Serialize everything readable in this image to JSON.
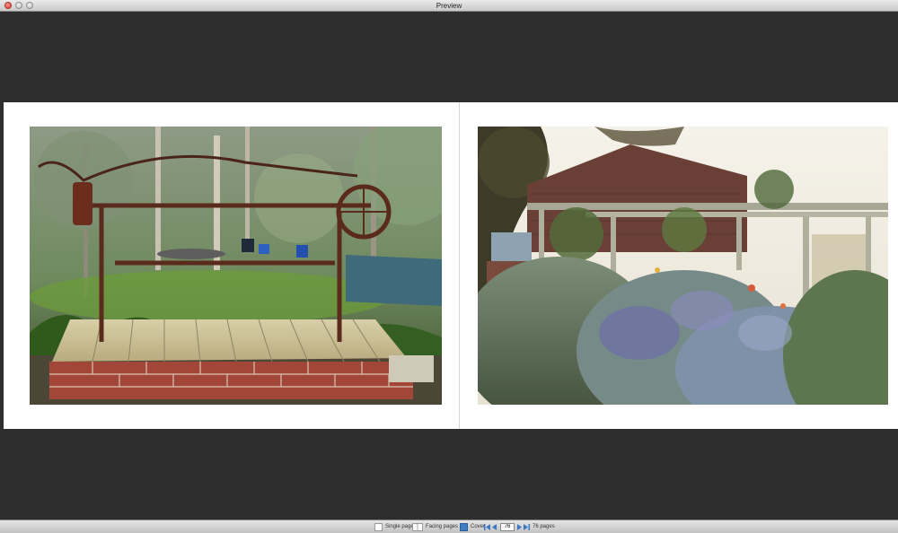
{
  "window": {
    "title": "Preview"
  },
  "toolbar": {
    "single_pages_label": "Single pages",
    "facing_pages_label": "Facing pages",
    "cover_label": "Cover",
    "current_page": "76",
    "page_count_label": "76 pages"
  },
  "colors": {
    "background": "#2e2e2e",
    "page": "#ffffff",
    "toolbar": "#d2d2d2",
    "accent": "#3f7fc6"
  }
}
